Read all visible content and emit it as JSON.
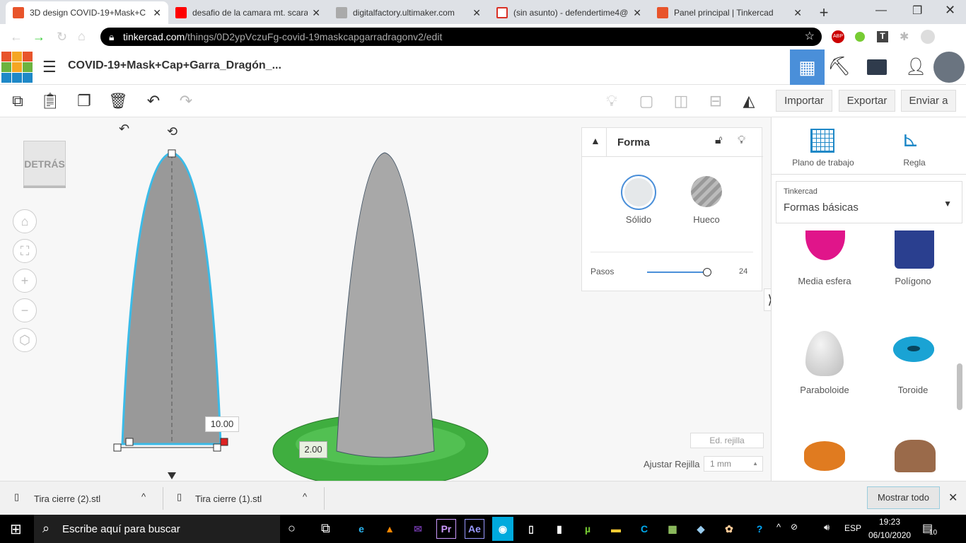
{
  "browser": {
    "tabs": [
      {
        "title": "3D design COVID-19+Mask+C",
        "active": true,
        "color": "#e8542b"
      },
      {
        "title": "desafio de la camara mt. scara",
        "color": "#ff0000"
      },
      {
        "title": "digitalfactory.ultimaker.com",
        "color": "#999999"
      },
      {
        "title": "(sin asunto) - defendertime4@",
        "color": "#d93025"
      },
      {
        "title": "Panel principal | Tinkercad",
        "color": "#e8542b"
      }
    ],
    "url_host": "tinkercad.com",
    "url_path": "/things/0D2ypVczuFg-covid-19maskcapgarradragonv2/edit"
  },
  "app": {
    "logo": [
      "T",
      "I",
      "N",
      "K",
      "E",
      "R",
      "C",
      "A",
      "D"
    ],
    "title": "COVID-19+Mask+Cap+Garra_Dragón_...",
    "import": "Importar",
    "export": "Exportar",
    "send": "Enviar a",
    "accent": "#4a8fd9"
  },
  "viewcube": "DETRÁS",
  "dimensions": {
    "width": "10.00",
    "height": "2.00"
  },
  "inspector": {
    "title": "Forma",
    "solid": "Sólido",
    "hole": "Hueco",
    "steps_label": "Pasos",
    "steps_value": "24",
    "steps_fraction": 1.0
  },
  "grid": {
    "edit": "Ed. rejilla",
    "adjust_label": "Ajustar Rejilla",
    "adjust_value": "1 mm"
  },
  "sidebar": {
    "workplane": "Plano de trabajo",
    "ruler": "Regla",
    "lib_source": "Tinkercad",
    "lib_name": "Formas básicas",
    "shapes": [
      {
        "label": "Media esfera",
        "color": "#e0158a"
      },
      {
        "label": "Polígono",
        "color": "#2a3f8f"
      },
      {
        "label": "Paraboloide",
        "color": "#d8d8d8"
      },
      {
        "label": "Toroide",
        "color": "#1aa3d4"
      },
      {
        "label": "",
        "color": "#e07b20"
      },
      {
        "label": "",
        "color": "#9a6a4a"
      }
    ]
  },
  "downloads": {
    "items": [
      "Tira cierre (2).stl",
      "Tira cierre (1).stl"
    ],
    "show_all": "Mostrar todo"
  },
  "taskbar": {
    "search": "Escribe aquí para buscar",
    "lang": "ESP",
    "time": "19:23",
    "date": "06/10/2020",
    "notifications": "10"
  }
}
